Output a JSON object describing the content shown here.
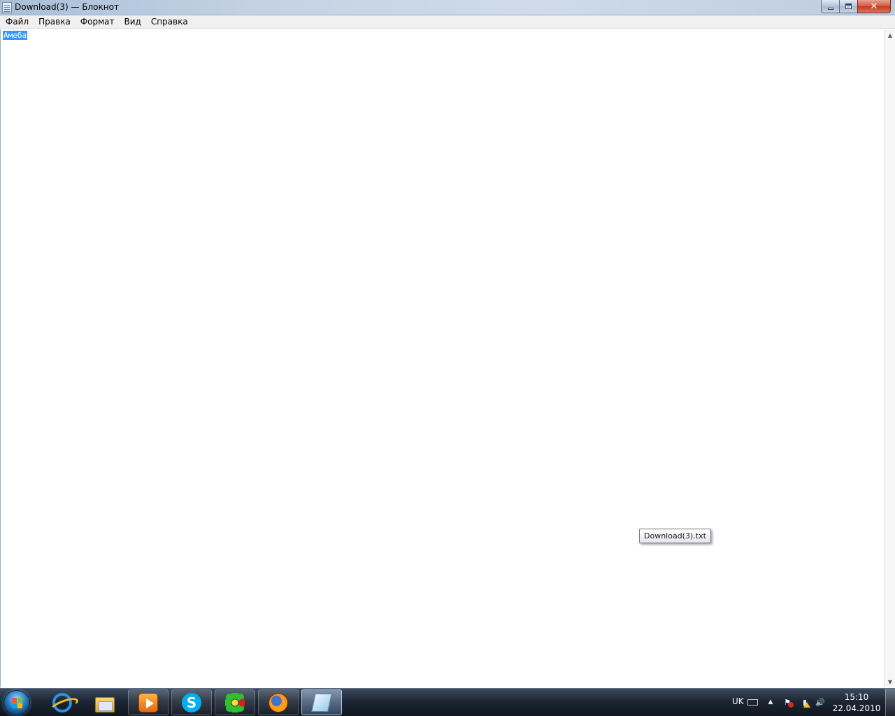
{
  "window": {
    "title": "Download(3) — Блокнот",
    "close_glyph": "✕"
  },
  "menu": {
    "items": [
      "Файл",
      "Правка",
      "Формат",
      "Вид",
      "Справка"
    ]
  },
  "editor": {
    "content": "Амеба",
    "selection_color": "#3399ff"
  },
  "scrollbar": {
    "up_glyph": "▲",
    "down_glyph": "▼"
  },
  "tooltip": {
    "text": "Download(3).txt"
  },
  "taskbar": {
    "buttons": [
      {
        "icon": "internet-explorer-icon",
        "state": "pinned"
      },
      {
        "icon": "windows-explorer-icon",
        "state": "pinned"
      },
      {
        "icon": "media-player-icon",
        "state": "running"
      },
      {
        "icon": "skype-icon",
        "state": "running",
        "glyph": "S"
      },
      {
        "icon": "icq-icon",
        "state": "running"
      },
      {
        "icon": "firefox-icon",
        "state": "running"
      },
      {
        "icon": "notepad-icon",
        "state": "active"
      }
    ],
    "tray": {
      "language": "UK",
      "arrow_glyph": "▲",
      "flag_glyph": "⚑",
      "network_glyph": "▮",
      "volume_glyph": "🔊",
      "time": "15:10",
      "date": "22.04.2010"
    }
  }
}
